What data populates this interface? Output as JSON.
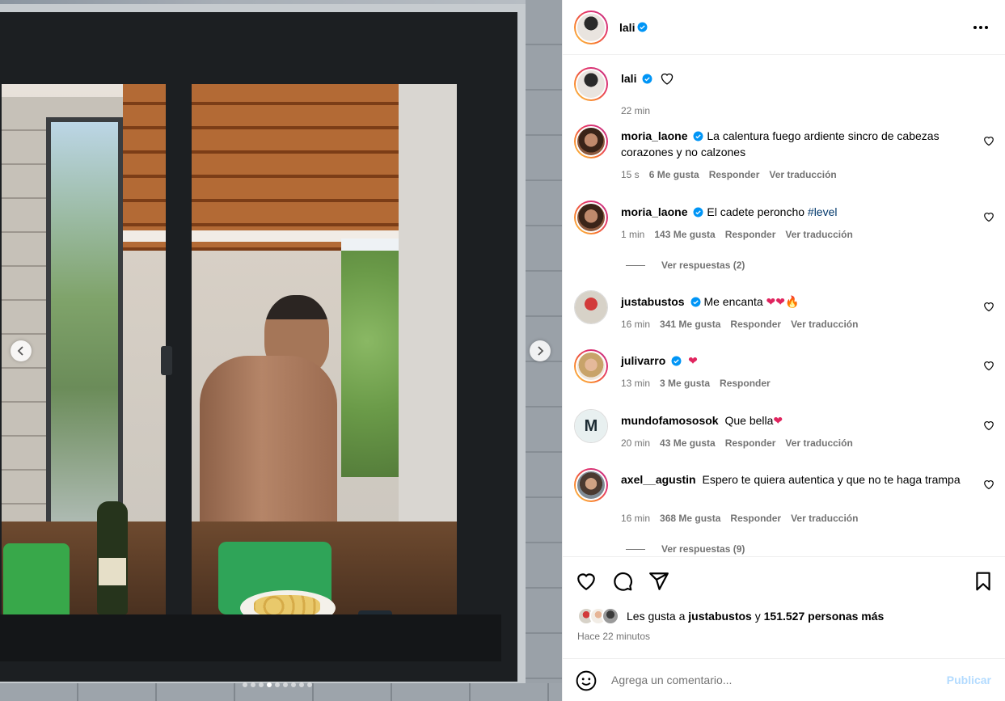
{
  "post": {
    "author": "lali",
    "posted_ago": "22 min"
  },
  "carousel": {
    "total_slides": 9,
    "current_slide": 4,
    "prev_icon": "chevron-left-icon",
    "next_icon": "chevron-right-icon"
  },
  "caption": {
    "username": "lali",
    "time": "22 min"
  },
  "comments": [
    {
      "username": "moria_laone",
      "verified": true,
      "text": "La calentura fuego ardiente sincro de cabezas corazones y no calzones",
      "time": "15 s",
      "likes": "6 Me gusta",
      "reply": "Responder",
      "translate": "Ver traducción"
    },
    {
      "username": "moria_laone",
      "verified": true,
      "text": "El cadete peroncho ",
      "hashtag": "#level",
      "time": "1 min",
      "likes": "143 Me gusta",
      "reply": "Responder",
      "translate": "Ver traducción",
      "view_replies": "Ver respuestas (2)"
    },
    {
      "username": "justabustos",
      "verified": true,
      "text": "Me encanta ",
      "emojis": "❤❤",
      "emoji_fire": "🔥",
      "time": "16 min",
      "likes": "341 Me gusta",
      "reply": "Responder",
      "translate": "Ver traducción"
    },
    {
      "username": "julivarro",
      "verified": true,
      "emojis": "❤",
      "time": "13 min",
      "likes": "3 Me gusta",
      "reply": "Responder"
    },
    {
      "username": "mundofamososok",
      "verified": false,
      "text": "Que bella",
      "emojis": "❤",
      "time": "20 min",
      "likes": "43 Me gusta",
      "reply": "Responder",
      "translate": "Ver traducción"
    },
    {
      "username": "axel__agustin",
      "verified": false,
      "text": "Espero te quiera autentica y que no te haga trampa",
      "time": "16 min",
      "likes": "368 Me gusta",
      "reply": "Responder",
      "translate": "Ver traducción",
      "view_replies": "Ver respuestas (9)"
    }
  ],
  "actions": {
    "like_icon": "heart-icon",
    "comment_icon": "comment-bubble-icon",
    "share_icon": "paper-plane-icon",
    "save_icon": "bookmark-icon"
  },
  "likes_summary": {
    "prefix": "Les gusta a ",
    "user": "justabustos",
    "middle": " y ",
    "count": "151.527 personas más"
  },
  "posted_full": "Hace 22 minutos",
  "composer": {
    "placeholder": "Agrega un comentario...",
    "publish_label": "Publicar"
  },
  "colors": {
    "verified_blue": "#0095f6",
    "muted_text": "#737373",
    "publish_disabled": "#b3dbff",
    "hashtag": "#00376b",
    "heart_red": "#e0245e"
  }
}
